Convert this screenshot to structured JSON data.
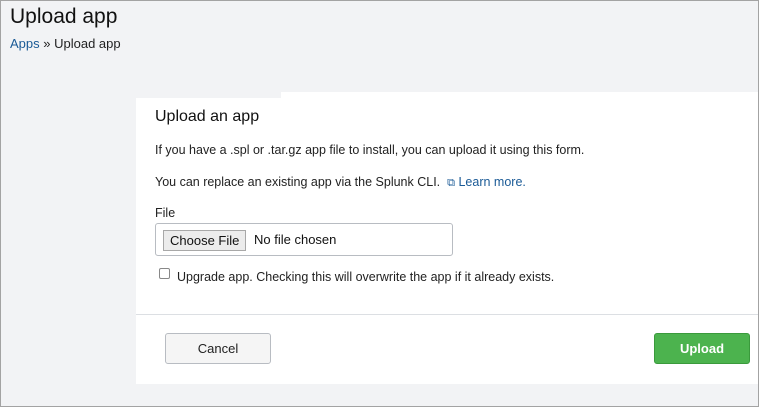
{
  "header": {
    "title": "Upload app",
    "breadcrumb": {
      "parent": "Apps",
      "separator": "»",
      "current": "Upload app"
    }
  },
  "panel": {
    "title": "Upload an app",
    "intro": "If you have a .spl or .tar.gz app file to install, you can upload it using this form.",
    "replace_text": "You can replace an existing app via the Splunk CLI.",
    "learn_more": "Learn more.",
    "file_label": "File",
    "choose_file": "Choose File",
    "no_file": "No file chosen",
    "upgrade_label": "Upgrade app. Checking this will overwrite the app if it already exists.",
    "upgrade_checked": false,
    "cancel": "Cancel",
    "upload": "Upload"
  },
  "colors": {
    "accent": "#4cb34e",
    "link": "#1a5a96"
  }
}
